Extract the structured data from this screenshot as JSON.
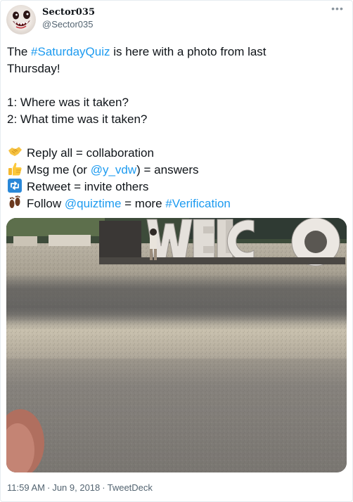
{
  "tweet": {
    "author": {
      "display_name": "Sector035",
      "handle": "@Sector035"
    },
    "more_icon": "more-horizontal-icon",
    "text": {
      "intro_1": "The ",
      "hashtag_quiz": "#SaturdayQuiz",
      "intro_2": " is here with a photo from last",
      "intro_3": "Thursday!",
      "question_1": "1: Where was it taken?",
      "question_2": "2: What time was it taken?",
      "reply_all": "Reply all = collaboration",
      "msg_me_1": "Msg me (or ",
      "msg_me_mention": "@y_vdw",
      "msg_me_2": ") = answers",
      "retweet": "Retweet = invite others",
      "follow_1": "Follow ",
      "follow_mention": "@quiztime",
      "follow_2": " = more ",
      "follow_hashtag": "#Verification"
    },
    "emojis": {
      "reply_all": "handshake-emoji",
      "msg_me": "thumbs-up-emoji",
      "retweet": "retweet-emoji",
      "follow": "footprints-emoji"
    },
    "photo": {
      "sign_letters": "WELCO"
    },
    "meta": {
      "time": "11:59 AM",
      "separator": "·",
      "date": "Jun 9, 2018",
      "source": "TweetDeck"
    }
  },
  "colors": {
    "link": "#1d9bf0",
    "text": "#0f1419",
    "secondary": "#536471"
  }
}
